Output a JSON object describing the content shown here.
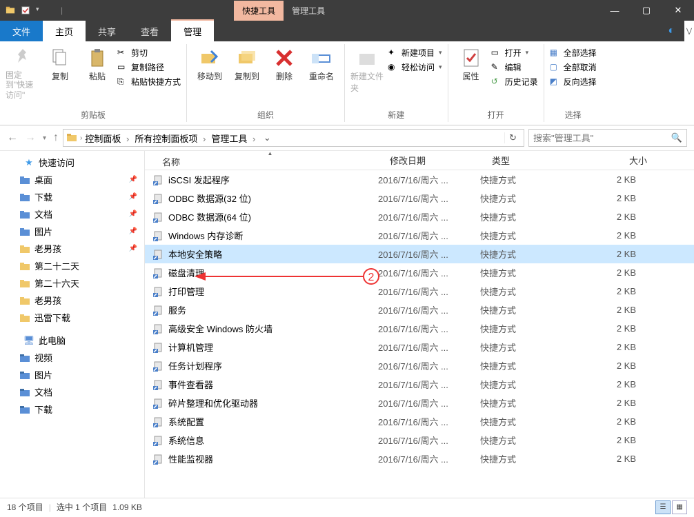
{
  "titlebar": {
    "contextual_tab": "快捷工具",
    "manage_tab": "管理工具"
  },
  "win_controls": {
    "min": "—",
    "max": "▢",
    "close": "✕"
  },
  "ribbon_tabs": {
    "file": "文件",
    "home": "主页",
    "share": "共享",
    "view": "查看",
    "manage": "管理"
  },
  "ribbon": {
    "clipboard": {
      "pin": "固定到\"快速访问\"",
      "copy": "复制",
      "paste": "粘贴",
      "cut": "剪切",
      "copy_path": "复制路径",
      "paste_shortcut": "粘贴快捷方式",
      "label": "剪贴板"
    },
    "organize": {
      "moveto": "移动到",
      "copyto": "复制到",
      "delete": "删除",
      "rename": "重命名",
      "label": "组织"
    },
    "new": {
      "newfolder": "新建文件夹",
      "newitem": "新建项目",
      "easyaccess": "轻松访问",
      "label": "新建"
    },
    "open": {
      "properties": "属性",
      "open": "打开",
      "edit": "编辑",
      "history": "历史记录",
      "label": "打开"
    },
    "select": {
      "selectall": "全部选择",
      "selectnone": "全部取消",
      "invert": "反向选择",
      "label": "选择"
    }
  },
  "address": {
    "crumbs": [
      "控制面板",
      "所有控制面板项",
      "管理工具"
    ],
    "search_placeholder": "搜索\"管理工具\""
  },
  "sidebar": {
    "quick_access": "快速访问",
    "items": [
      {
        "label": "桌面",
        "icon": "desktop",
        "pinned": true
      },
      {
        "label": "下载",
        "icon": "downloads",
        "pinned": true
      },
      {
        "label": "文档",
        "icon": "documents",
        "pinned": true
      },
      {
        "label": "图片",
        "icon": "pictures",
        "pinned": true
      },
      {
        "label": "老男孩",
        "icon": "folder",
        "pinned": true
      },
      {
        "label": "第二十二天",
        "icon": "folder",
        "pinned": false
      },
      {
        "label": "第二十六天",
        "icon": "folder",
        "pinned": false
      },
      {
        "label": "老男孩",
        "icon": "folder",
        "pinned": false
      },
      {
        "label": "迅雷下载",
        "icon": "folder",
        "pinned": false
      }
    ],
    "this_pc": "此电脑",
    "pc_items": [
      {
        "label": "视频",
        "icon": "videos"
      },
      {
        "label": "图片",
        "icon": "pictures"
      },
      {
        "label": "文档",
        "icon": "documents"
      },
      {
        "label": "下载",
        "icon": "downloads"
      }
    ]
  },
  "columns": {
    "name": "名称",
    "date": "修改日期",
    "type": "类型",
    "size": "大小"
  },
  "files": [
    {
      "name": "iSCSI 发起程序",
      "date": "2016/7/16/周六 ...",
      "type": "快捷方式",
      "size": "2 KB",
      "selected": false
    },
    {
      "name": "ODBC 数据源(32 位)",
      "date": "2016/7/16/周六 ...",
      "type": "快捷方式",
      "size": "2 KB",
      "selected": false
    },
    {
      "name": "ODBC 数据源(64 位)",
      "date": "2016/7/16/周六 ...",
      "type": "快捷方式",
      "size": "2 KB",
      "selected": false
    },
    {
      "name": "Windows 内存诊断",
      "date": "2016/7/16/周六 ...",
      "type": "快捷方式",
      "size": "2 KB",
      "selected": false
    },
    {
      "name": "本地安全策略",
      "date": "2016/7/16/周六 ...",
      "type": "快捷方式",
      "size": "2 KB",
      "selected": true
    },
    {
      "name": "磁盘清理",
      "date": "2016/7/16/周六 ...",
      "type": "快捷方式",
      "size": "2 KB",
      "selected": false
    },
    {
      "name": "打印管理",
      "date": "2016/7/16/周六 ...",
      "type": "快捷方式",
      "size": "2 KB",
      "selected": false
    },
    {
      "name": "服务",
      "date": "2016/7/16/周六 ...",
      "type": "快捷方式",
      "size": "2 KB",
      "selected": false
    },
    {
      "name": "高级安全 Windows 防火墙",
      "date": "2016/7/16/周六 ...",
      "type": "快捷方式",
      "size": "2 KB",
      "selected": false
    },
    {
      "name": "计算机管理",
      "date": "2016/7/16/周六 ...",
      "type": "快捷方式",
      "size": "2 KB",
      "selected": false
    },
    {
      "name": "任务计划程序",
      "date": "2016/7/16/周六 ...",
      "type": "快捷方式",
      "size": "2 KB",
      "selected": false
    },
    {
      "name": "事件查看器",
      "date": "2016/7/16/周六 ...",
      "type": "快捷方式",
      "size": "2 KB",
      "selected": false
    },
    {
      "name": "碎片整理和优化驱动器",
      "date": "2016/7/16/周六 ...",
      "type": "快捷方式",
      "size": "2 KB",
      "selected": false
    },
    {
      "name": "系统配置",
      "date": "2016/7/16/周六 ...",
      "type": "快捷方式",
      "size": "2 KB",
      "selected": false
    },
    {
      "name": "系统信息",
      "date": "2016/7/16/周六 ...",
      "type": "快捷方式",
      "size": "2 KB",
      "selected": false
    },
    {
      "name": "性能监视器",
      "date": "2016/7/16/周六 ...",
      "type": "快捷方式",
      "size": "2 KB",
      "selected": false
    }
  ],
  "statusbar": {
    "count": "18 个项目",
    "selected": "选中 1 个项目",
    "size": "1.09 KB"
  },
  "annotation_number": "2"
}
